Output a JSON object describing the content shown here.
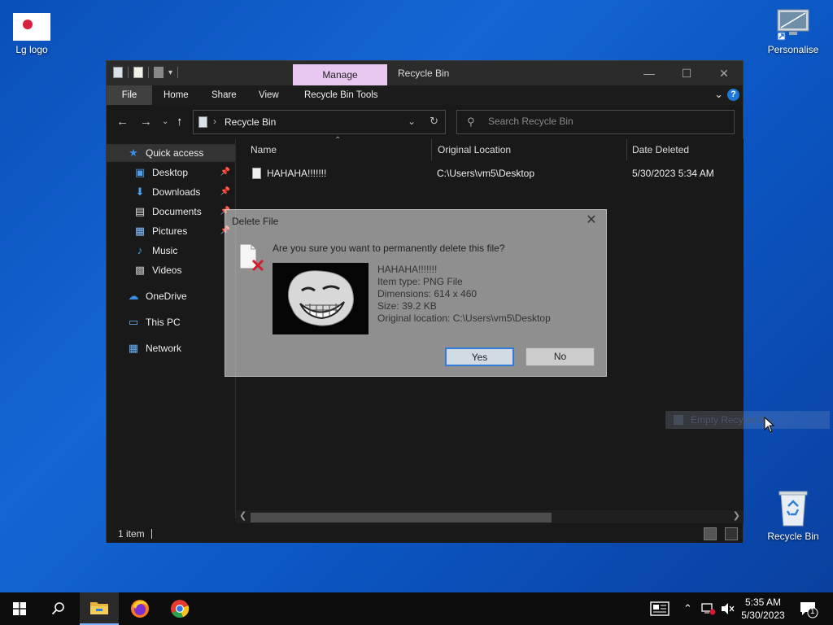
{
  "desktop": {
    "icons": [
      {
        "label": "Lg logo"
      },
      {
        "label": "Personalise"
      },
      {
        "label": "Recycle Bin"
      }
    ]
  },
  "window": {
    "title": "Recycle Bin",
    "manage_tab": "Manage",
    "ribbon_tabs": [
      "File",
      "Home",
      "Share",
      "View",
      "Recycle Bin Tools"
    ],
    "help": "?",
    "address": "Recycle Bin",
    "search_placeholder": "Search Recycle Bin",
    "nav": [
      {
        "label": "Quick access",
        "icon": "star-icon"
      },
      {
        "label": "Desktop",
        "icon": "desktop-folder-icon",
        "pinned": true
      },
      {
        "label": "Downloads",
        "icon": "download-icon",
        "pinned": true
      },
      {
        "label": "Documents",
        "icon": "document-icon",
        "pinned": true
      },
      {
        "label": "Pictures",
        "icon": "pictures-icon",
        "pinned": true
      },
      {
        "label": "Music",
        "icon": "music-icon"
      },
      {
        "label": "Videos",
        "icon": "video-icon"
      },
      {
        "label": "OneDrive",
        "icon": "cloud-icon"
      },
      {
        "label": "This PC",
        "icon": "pc-icon"
      },
      {
        "label": "Network",
        "icon": "network-icon"
      }
    ],
    "columns": [
      "Name",
      "Original Location",
      "Date Deleted"
    ],
    "rows": [
      {
        "name": "HAHAHA!!!!!!!",
        "location": "C:\\Users\\vm5\\Desktop",
        "date": "5/30/2023 5:34 AM"
      }
    ],
    "status": "1 item"
  },
  "dialog": {
    "title": "Delete File",
    "question": "Are you sure you want to permanently delete this file?",
    "file_name": "HAHAHA!!!!!!!",
    "item_type": "Item type: PNG File",
    "dimensions": "Dimensions: 614 x 460",
    "size": "Size: 39.2 KB",
    "original_location": "Original location: C:\\Users\\vm5\\Desktop",
    "yes": "Yes",
    "no": "No"
  },
  "context_menu": {
    "item": "Empty Recycle Bin"
  },
  "taskbar": {
    "time": "5:35 AM",
    "date": "5/30/2023",
    "notification_count": "1"
  },
  "colors": {
    "accent": "#2f7bd6",
    "manage_tab": "#e8c8f0",
    "window_bg": "#191919"
  }
}
